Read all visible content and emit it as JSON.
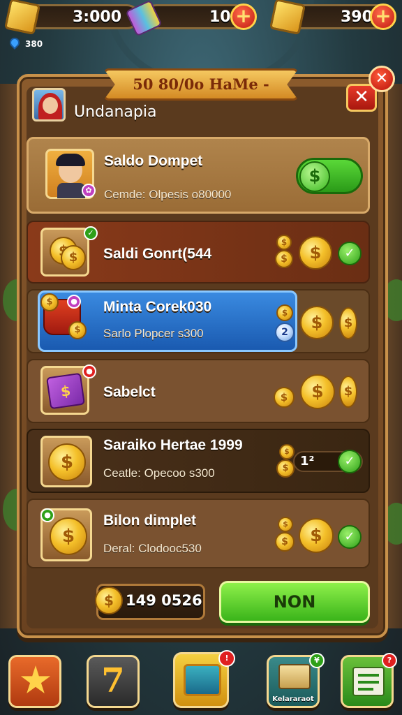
{
  "topbar": {
    "coins_value": "3:000",
    "energy_value": "10",
    "gems_value": "390",
    "location_text": "380"
  },
  "panel": {
    "title": "50 80/0o HaMe -",
    "user_name": "Undanapia"
  },
  "rows": [
    {
      "title": "Saldo Dompet",
      "subtitle": "Cemde: Olpesis o80000"
    },
    {
      "title": "Saldi Gonrt(544",
      "subtitle": ""
    },
    {
      "title": "Minta Corek030",
      "subtitle": "Sarlo Plopcer s300"
    },
    {
      "title": "Sabelct",
      "subtitle": ""
    },
    {
      "title": "Saraiko Hertae 1999",
      "subtitle": "Ceatle: Opecoo s300"
    },
    {
      "title": "Bilon dimplet",
      "subtitle": "Deral: Clodooc530"
    }
  ],
  "row_badge_value": "1²",
  "footer": {
    "total_value": "149 0526",
    "main_button": "NON"
  },
  "nav": {
    "building_label": "Kelararaot"
  },
  "colors": {
    "panel_wood": "#8a5a2c",
    "highlight_row": "#2a7ad0",
    "accent_green": "#3ab41a",
    "coin_gold": "#f4c02a"
  }
}
